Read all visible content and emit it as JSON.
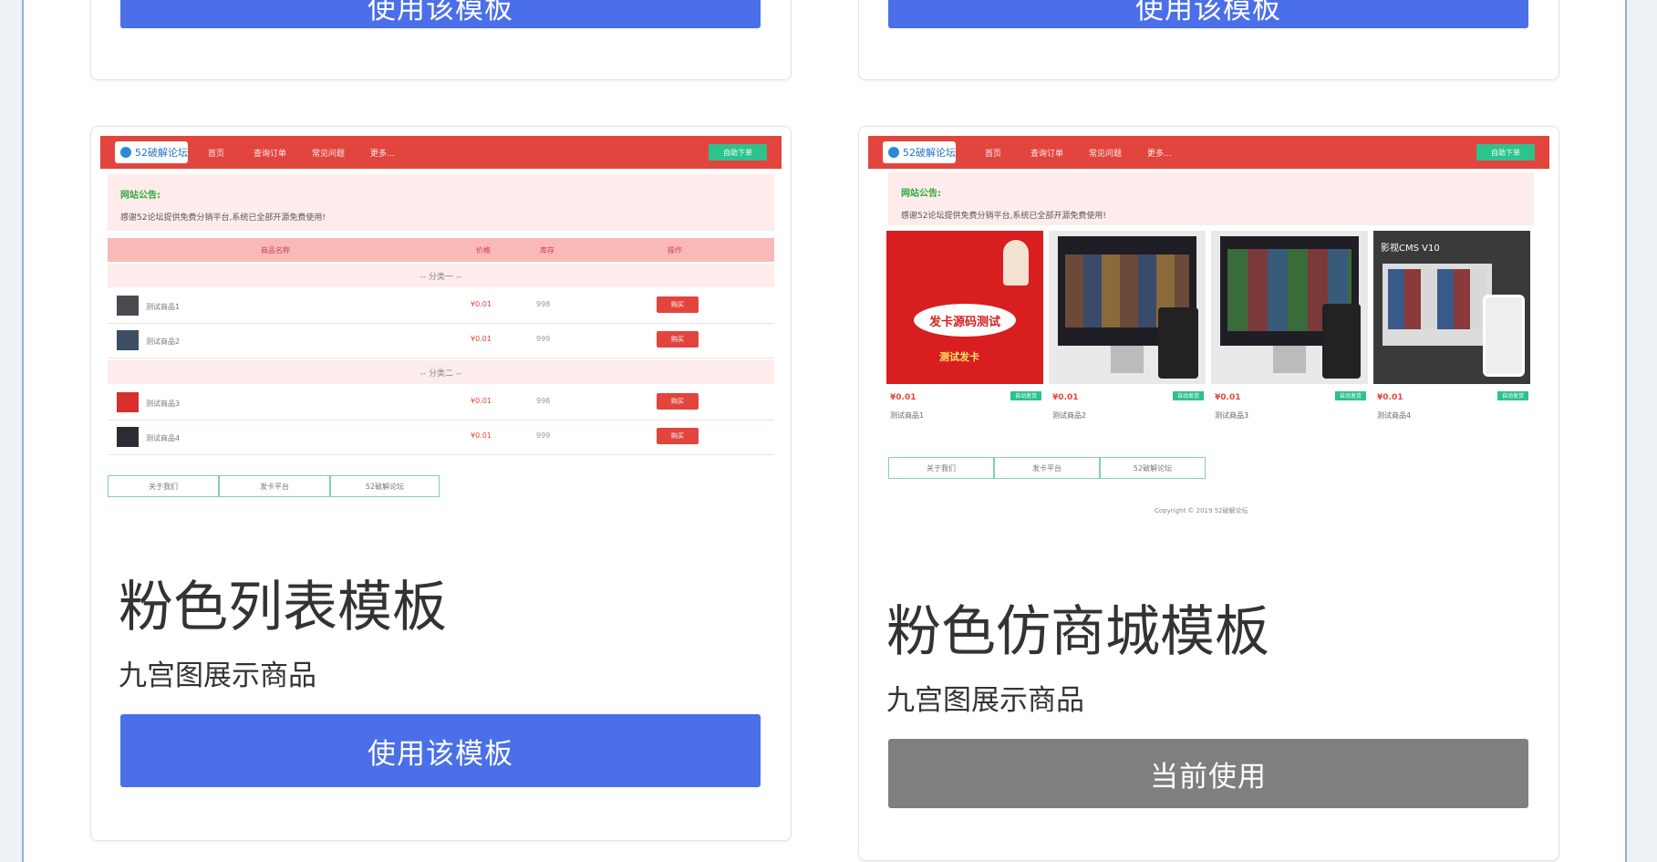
{
  "cards": {
    "top_left": {
      "button_label": "使用该模板"
    },
    "top_right": {
      "button_label": "使用该模板"
    },
    "pink_list": {
      "title": "粉色列表模板",
      "subtitle": "九宫图展示商品",
      "button_label": "使用该模板",
      "preview": {
        "logo": "52破解论坛",
        "nav_items": [
          "首页",
          "查询订单",
          "常见问题",
          "更多..."
        ],
        "nav_button": "自助下单",
        "notice_title": "网站公告:",
        "notice_text": "感谢52论坛提供免费分销平台,系统已全部开源免费使用!",
        "table_headers": [
          "商品名称",
          "价格",
          "库存",
          "操作"
        ],
        "groups": [
          "-- 分类一 --",
          "-- 分类二 --"
        ],
        "rows": [
          {
            "name": "测试商品1",
            "price": "¥0.01",
            "stock": "998",
            "buy": "购买"
          },
          {
            "name": "测试商品2",
            "price": "¥0.01",
            "stock": "999",
            "buy": "购买"
          },
          {
            "name": "测试商品3",
            "price": "¥0.01",
            "stock": "998",
            "buy": "购买"
          },
          {
            "name": "测试商品4",
            "price": "¥0.01",
            "stock": "999",
            "buy": "购买"
          }
        ],
        "links": [
          "关于我们",
          "发卡平台",
          "52破解论坛"
        ]
      }
    },
    "pink_mall": {
      "title": "粉色仿商城模板",
      "subtitle": "九宫图展示商品",
      "button_label": "当前使用",
      "preview": {
        "logo": "52破解论坛",
        "nav_items": [
          "首页",
          "查询订单",
          "常见问题",
          "更多..."
        ],
        "nav_button": "自助下单",
        "notice_title": "网站公告:",
        "notice_text": "感谢52论坛提供免费分销平台,系统已全部开源免费使用!",
        "products": [
          {
            "price": "¥0.01",
            "name": "测试商品1",
            "tag": "自动发货",
            "banner": "发卡源码测试",
            "banner_sub": "测试发卡"
          },
          {
            "price": "¥0.01",
            "name": "测试商品2",
            "tag": "自动发货"
          },
          {
            "price": "¥0.01",
            "name": "测试商品3",
            "tag": "自动发货"
          },
          {
            "price": "¥0.01",
            "name": "测试商品4",
            "tag": "自动发货",
            "banner": "影视CMS V10"
          }
        ],
        "links": [
          "关于我们",
          "发卡平台",
          "52破解论坛"
        ],
        "copyright": "Copyright © 2019 52破解论坛"
      }
    }
  },
  "colors": {
    "primary_button": "#4a6fe8",
    "current_button": "#7f7f7f",
    "preview_nav": "#e2453e",
    "accent_green": "#2ec28c"
  }
}
